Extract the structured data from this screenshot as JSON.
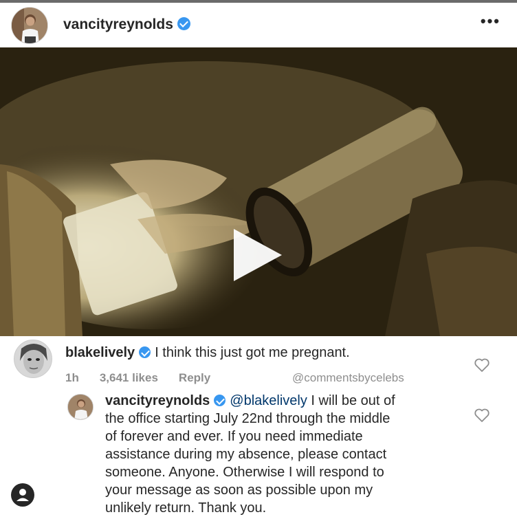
{
  "post": {
    "author": "vancityreynolds",
    "more_label": "•••"
  },
  "comments": [
    {
      "username": "blakelively",
      "text": "I think this just got me pregnant.",
      "time": "1h",
      "likes": "3,641 likes",
      "reply_label": "Reply",
      "watermark": "@commentsbycelebs"
    },
    {
      "username": "vancityreynolds",
      "mention": "@blakelively",
      "text_line1": " I will be out of",
      "text_lines": [
        "the office starting July 22nd through the middle",
        "of forever and ever. If you need immediate",
        "assistance during my absence, please contact",
        "someone. Anyone. Otherwise I will respond to",
        "your message as soon as possible upon my",
        "unlikely return. Thank you."
      ]
    }
  ],
  "colors": {
    "verified": "#3897f0",
    "mention": "#00376b",
    "meta": "#8e8e8e"
  }
}
